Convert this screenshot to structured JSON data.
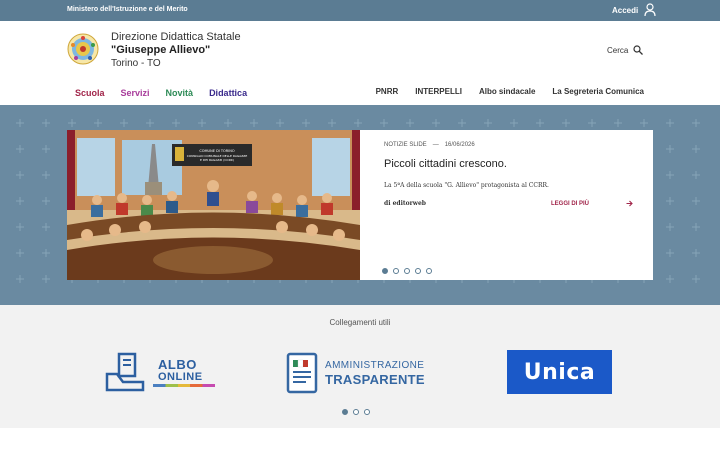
{
  "topbar": {
    "ministry": "Ministero dell'Istruzione e del Merito",
    "login_label": "Accedi",
    "bg_color": "#5b7c93"
  },
  "header": {
    "line1": "Direzione Didattica Statale",
    "line2": "\"Giuseppe Allievo\"",
    "line3": "Torino - TO",
    "search_label": "Cerca"
  },
  "main_nav": [
    {
      "label": "Scuola",
      "color": "#a1254a"
    },
    {
      "label": "Servizi",
      "color": "#a83c9b"
    },
    {
      "label": "Novità",
      "color": "#2e8b57"
    },
    {
      "label": "Didattica",
      "color": "#3a2a8c"
    }
  ],
  "secondary_nav": [
    "PNRR",
    "INTERPELLI",
    "Albo sindacale",
    "La Segreteria Comunica"
  ],
  "slide": {
    "category": "NOTIZIE SLIDE",
    "separator": "—",
    "date": "16/06/2026",
    "title": "Piccoli cittadini crescono.",
    "excerpt": "La 5ªA della scuola \"G. Allievo\" protagonista al CCRR.",
    "author": "di editorweb",
    "read_more": "LEGGI DI PIÙ",
    "sign_text": "COMUNE DI TORINO CONSIGLIO COMUNALE DELLE RAGAZZE E DEI RAGAZZI (CCRR)",
    "dots": 5,
    "active_dot": 0
  },
  "links": {
    "title": "Collegamenti utili",
    "albo_line1": "ALBO",
    "albo_line2": "ONLINE",
    "amm_line1": "AMMINISTRAZIONE",
    "amm_line2": "TRASPARENTE",
    "unica": "Unica",
    "dots": 3,
    "active_dot": 0
  }
}
